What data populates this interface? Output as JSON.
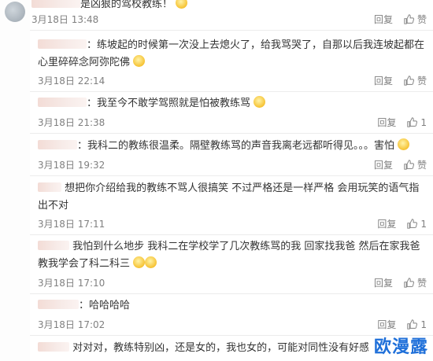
{
  "comments": [
    {
      "text": "是凶狠的驾校教练！",
      "date": "3月18日 13:48",
      "reply": "回复",
      "like": "赞"
    },
    {
      "text": "练坡起的时候第一次没上去熄火了，给我骂哭了，自那以后我连坡起都在心里碎碎念阿弥陀佛",
      "date": "3月18日 22:14",
      "reply": "回复",
      "like": "赞"
    },
    {
      "text": "我至今不敢学驾照就是怕被教练骂",
      "date": "3月18日 21:38",
      "reply": "回复",
      "like": "1"
    },
    {
      "text": "我科二的教练很温柔。隔壁教练骂的声音我离老远都听得见。。。害怕",
      "date": "3月18日 19:32",
      "reply": "回复",
      "like": "赞"
    },
    {
      "text": "想把你介绍给我的教练不骂人很搞笑 不过严格还是一样严格 会用玩笑的语气指出不对",
      "date": "3月18日 17:11",
      "reply": "回复",
      "like": "1"
    },
    {
      "text": "我怕到什么地步 我科二在学校学了几次教练骂的我 回家找我爸 然后在家我爸教我学会了科二科三",
      "date": "3月18日 17:10",
      "reply": "回复",
      "like": "赞"
    },
    {
      "text": "哈哈哈哈",
      "date": "3月18日 17:02",
      "reply": "回复",
      "like": "1"
    },
    {
      "text": "对对对，教练特别凶，还是女的，我也女的，可能对同性没有好感吧",
      "date": "",
      "reply": "",
      "like": ""
    }
  ],
  "watermark": "欧漫露"
}
